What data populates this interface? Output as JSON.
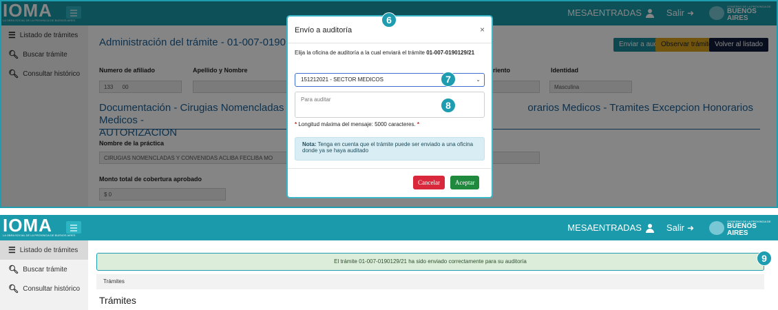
{
  "brand": {
    "logo_text": "IOMA",
    "logo_subtitle": "LA OBRA SOCIAL DE LA PROVINCIA DE BUENOS AIRES",
    "gov_small": "GOBIERNO DE LA PROVINCIA DE",
    "gov_big": "BUENOS AIRES"
  },
  "navbar": {
    "user": "MESAENTRADAS",
    "logout": "Salir"
  },
  "sidebar": {
    "items": [
      {
        "label": "Listado de trámites",
        "icon": "list-icon"
      },
      {
        "label": "Buscar trámite",
        "icon": "search-icon"
      },
      {
        "label": "Consultar histórico",
        "icon": "search-icon"
      }
    ]
  },
  "screen1": {
    "page_title": "Administración del trámite - 01-007-0190129",
    "buttons": {
      "enviar": "Enviar a auditar",
      "observar": "Observar trámite",
      "volver": "Volver al listado"
    },
    "fields": {
      "afiliado_label": "Numero de afiliado",
      "afiliado_value1": "133",
      "afiliado_value2": "00",
      "apellido_label": "Apellido y Nombre",
      "nacimiento_label": "riento",
      "identidad_label": "Identidad",
      "identidad_value": "Masculina",
      "practica_label": "Nombre de la práctica",
      "practica_value": "CIRUGIAS NOMENCLADAS Y CONVENIDAS ACLIBA FECLIBA MO",
      "monto_label": "Monto total de cobertura aprobado",
      "monto_value": "$ 0"
    },
    "section_title_left": "Documentación - Cirugias Nomencladas Y",
    "section_title_right": "orarios Medicos - Tramites Excepcion Honorarios Medicos -",
    "section_title_line2": "AUTORIZACION"
  },
  "modal": {
    "title": "Envío a auditoría",
    "close": "×",
    "desc_prefix": "Elija la oficina de auditoría a la cual enviará el trámite ",
    "desc_tramite": "01-007-0190129/21",
    "select_value": "151212021 - SECTOR MEDICOS",
    "textarea_placeholder": "Para auditar",
    "hint": "Longitud máxima del mensaje: 5000 caracteres.",
    "note_bold": "Nota:",
    "note_text": " Tenga en cuenta que el trámite puede ser enviado a una oficina donde ya se haya auditado",
    "cancel": "Cancelar",
    "accept": "Aceptar"
  },
  "markers": {
    "m6": "6",
    "m7": "7",
    "m8": "8",
    "m9": "9"
  },
  "screen2": {
    "alert": "El trámite 01-007-0190129/21 ha sido enviado correctamente para su auditoría",
    "breadcrumb": "Trámites",
    "heading": "Trámites"
  },
  "colors": {
    "navbar": "#1a9aaa",
    "accent": "#1e9cb0",
    "title": "#1a5f95",
    "cancel": "#d9283b",
    "accept": "#1f8a3d"
  }
}
